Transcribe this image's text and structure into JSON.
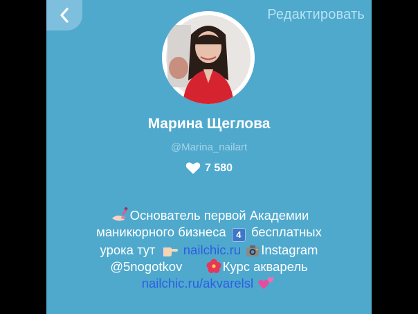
{
  "header": {
    "back_icon": "chevron-left-icon",
    "edit_label": "Редактировать"
  },
  "profile": {
    "name": "Марина Щеглова",
    "handle": "@Marina_nailart",
    "likes_icon": "heart-icon",
    "likes_count": "7 580"
  },
  "bio": {
    "line1_text": "Основатель первой Академии",
    "line2_text_a": "маникюрного бизнеса",
    "line2_badge": "4",
    "line2_text_b": "бесплатных",
    "line3_text_a": "урока тут",
    "line3_link": "nailchic.ru",
    "line3_text_b": "Instagram",
    "line4_text_a": "@5nogotkov",
    "line4_text_b": "Курс акварель",
    "line5_link": "nailchic.ru/akvarelsl"
  },
  "colors": {
    "background": "#4EA9CD",
    "link": "#2D5FE0",
    "edit": "#B9E2F2"
  }
}
